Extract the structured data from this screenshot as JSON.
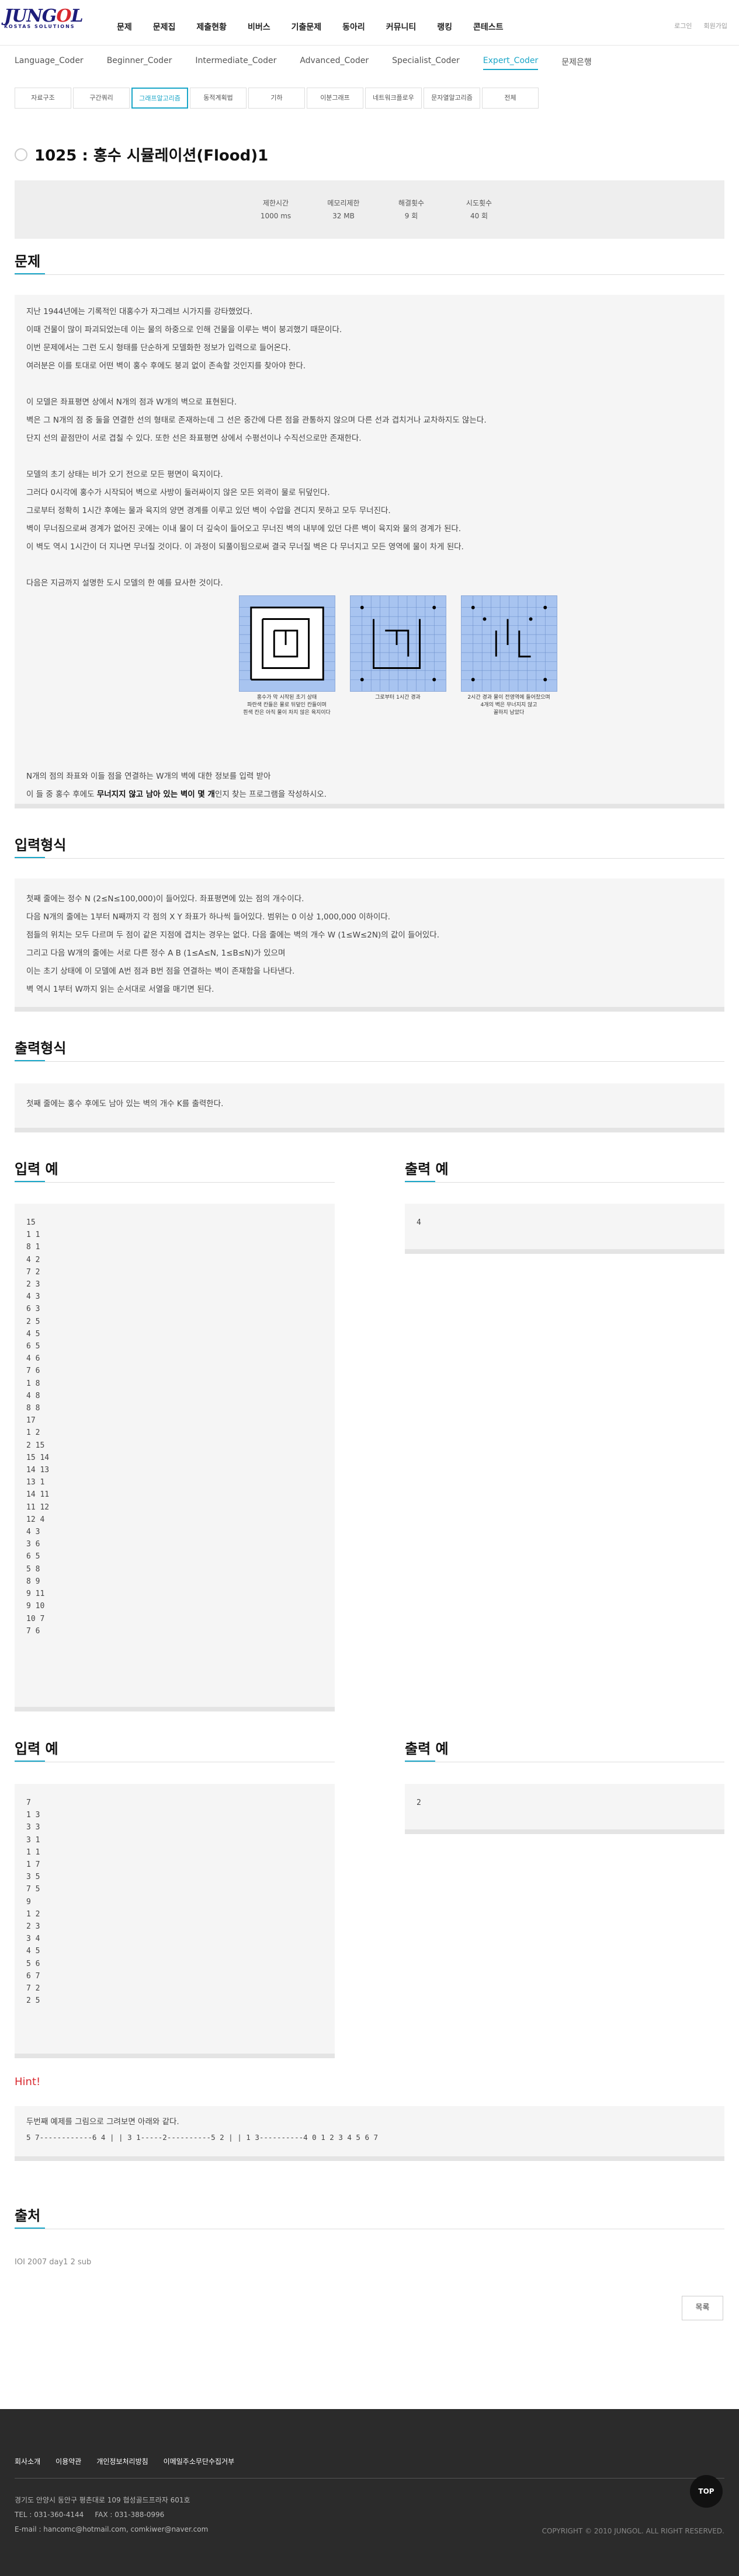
{
  "logo": {
    "main": "JUNGOL",
    "sub": "KOSTAS SOLUTIONS"
  },
  "gnb": [
    "문제",
    "문제집",
    "제출현황",
    "비버스",
    "기출문제",
    "동아리",
    "커뮤니티",
    "랭킹",
    "콘테스트"
  ],
  "util": [
    "로그인",
    "회원가입"
  ],
  "subnav": {
    "items": [
      "Language_Coder",
      "Beginner_Coder",
      "Intermediate_Coder",
      "Advanced_Coder",
      "Specialist_Coder",
      "Expert_Coder",
      "문제은행"
    ],
    "active_index": 5
  },
  "tabs": {
    "items": [
      "자료구조",
      "구간쿼리",
      "그래프알고리즘",
      "동적계획법",
      "기하",
      "이분그래프",
      "네트워크플로우",
      "문자열알고리즘",
      "전체"
    ],
    "active_index": 2
  },
  "problem": {
    "title": "1025 : 홍수 시뮬레이션(Flood)1"
  },
  "limits": [
    {
      "label": "제한시간",
      "value": "1000 ms"
    },
    {
      "label": "메모리제한",
      "value": "32 MB"
    },
    {
      "label": "해결횟수",
      "value": "9 회"
    },
    {
      "label": "시도횟수",
      "value": "40 회"
    }
  ],
  "sections": {
    "problem": "문제",
    "input": "입력형식",
    "output": "출력형식",
    "sample_in": "입력 예",
    "sample_out": "출력 예",
    "hint": "Hint!",
    "source": "출처"
  },
  "statement": {
    "p1": [
      "지난 1944년에는 기록적인 대홍수가 자그레브 시가지를 강타했었다.",
      "이때 건물이 많이 파괴되었는데 이는 물의 하중으로 인해 건물을 이루는 벽이 붕괴했기 때문이다.",
      "이번 문제에서는 그런 도시 형태를 단순하게 모델화한 정보가 입력으로 들어온다.",
      "여러분은 이를 토대로 어떤 벽이 홍수 후에도 붕괴 없이 존속할 것인지를 찾아야 한다."
    ],
    "p2": [
      "이 모델은 좌표평면 상에서 N개의 점과 W개의 벽으로 표현된다.",
      "벽은 그 N개의 점 중 둘을 연결한 선의 형태로 존재하는데 그 선은 중간에 다른 점을 관통하지 않으며 다른 선과 겹치거나 교차하지도 않는다.",
      "단지 선의 끝점만이 서로 겹칠 수 있다. 또한 선은 좌표평면 상에서 수평선이나 수직선으로만 존재한다."
    ],
    "p3": [
      "모델의 초기 상태는 비가 오기 전으로 모든 평면이 육지이다.",
      "그러다 0시각에 홍수가 시작되어 벽으로 사방이 둘러싸이지 않은 모든 외곽이 물로 뒤덮인다.",
      "그로부터 정확히 1시간 후에는 물과 육지의 양면 경계를 이루고 있던 벽이 수압을 견디지 못하고 모두 무너진다.",
      "벽이 무너짐으로써 경계가 없어진 곳에는 이내 물이 더 깊숙이 들어오고 무너진 벽의 내부에 있던 다른 벽이 육지와 물의 경계가 된다.",
      "이 벽도 역시 1시간이 더 지나면 무너질 것이다. 이 과정이 되풀이됨으로써 결국 무너질 벽은 다 무너지고 모든 영역에 물이 차게 된다."
    ],
    "p4": "다음은 지금까지 설명한 도시 모델의 한 예를 묘사한 것이다.",
    "p5a": "N개의 점의 좌표와 이들 점을 연결하는 W개의 벽에 대한 정보를 입력 받아",
    "p5b_pre": "이 들 중 홍수 후에도 ",
    "p5b_bold": "무너지지 않고 남아 있는 벽이 몇 개",
    "p5b_post": "인지 찾는 프로그램을 작성하시오."
  },
  "figures": [
    {
      "caption": "홍수가 막 시작된 초기 상태\n 파란색 칸들은 물로 뒤덮인 칸들이며\n 흰색 칸은 아직 물이 차지 않은 육지이다"
    },
    {
      "caption": "그로부터 1시간 경과"
    },
    {
      "caption": "2시간 경과 물이 전영역에 들어찼으며\n 4개의 벽은 무너지지 않고\n 꼴하지 남았다"
    }
  ],
  "input_spec": [
    "첫째 줄에는 정수 N (2≤N≤100,000)이 들어있다. 좌표평면에 있는 점의 개수이다.",
    "다음 N개의 줄에는 1부터 N째까지 각 점의 X Y 좌표가 하나씩 들어있다. 범위는 0 이상 1,000,000 이하이다.",
    "점들의 위치는 모두 다르며 두 점이 같은 지점에 겹치는 경우는 없다. 다음 줄에는 벽의 개수 W (1≤W≤2N)의 값이 들어있다.",
    "그리고 다음 W개의 줄에는 서로 다른 정수 A B (1≤A≤N, 1≤B≤N)가 있으며",
    "이는 초기 상태에 이 모델에 A번 점과 B번 점을 연결하는 벽이 존재함을 나타낸다.",
    "벽 역시 1부터 W까지 읽는 순서대로 서열을 매기면 된다."
  ],
  "output_spec": "첫째 줄에는 홍수 후에도 남아 있는 벽의 개수 K를 출력한다.",
  "sample1": {
    "input": [
      "15",
      "1 1",
      "8 1",
      "4 2",
      "7 2",
      "2 3",
      "4 3",
      "6 3",
      "2 5",
      "4 5",
      "6 5",
      "4 6",
      "7 6",
      "1 8",
      "4 8",
      "8 8",
      "17",
      "1 2",
      "2 15",
      "15 14",
      "14 13",
      "13 1",
      "14 11",
      "11 12",
      "12 4",
      "4 3",
      "3 6",
      "6 5",
      "5 8",
      "8 9",
      "9 11",
      "9 10",
      "10 7",
      "7 6"
    ],
    "output": "4"
  },
  "sample2": {
    "input": [
      "7",
      "1 3",
      "3 3",
      "3 1",
      "1 1",
      "1 7",
      "3 5",
      "7 5",
      "9",
      "1 2",
      "2 3",
      "3 4",
      "4 5",
      "5 6",
      "6 7",
      "7 2",
      "2 5"
    ],
    "output": "2"
  },
  "hint_text": "두번째 예제를 그림으로 그려보면 아래와 같다.",
  "hint_ascii": "5 7------------6 4 | | 3 1-----2----------5 2 | | 1 3----------4 0 1 2 3 4 5 6 7",
  "source_text": "IOI 2007 day1 2 sub",
  "list_button": "목록",
  "footer": {
    "links": [
      "회사소개",
      "이용약관",
      "개인정보처리방침",
      "이메일주소무단수집거부"
    ],
    "address": "경기도 안양시 동안구 평촌대로 109 협성골드프라자 601호",
    "tel": "TEL : 031-360-4144     FAX : 031-388-0996",
    "email": "E-mail : hancomc@hotmail.com, comkiwer@naver.com",
    "copyright": "COPYRIGHT © 2010 JUNGOL. ALL RIGHT RESERVED.",
    "top": "TOP"
  }
}
